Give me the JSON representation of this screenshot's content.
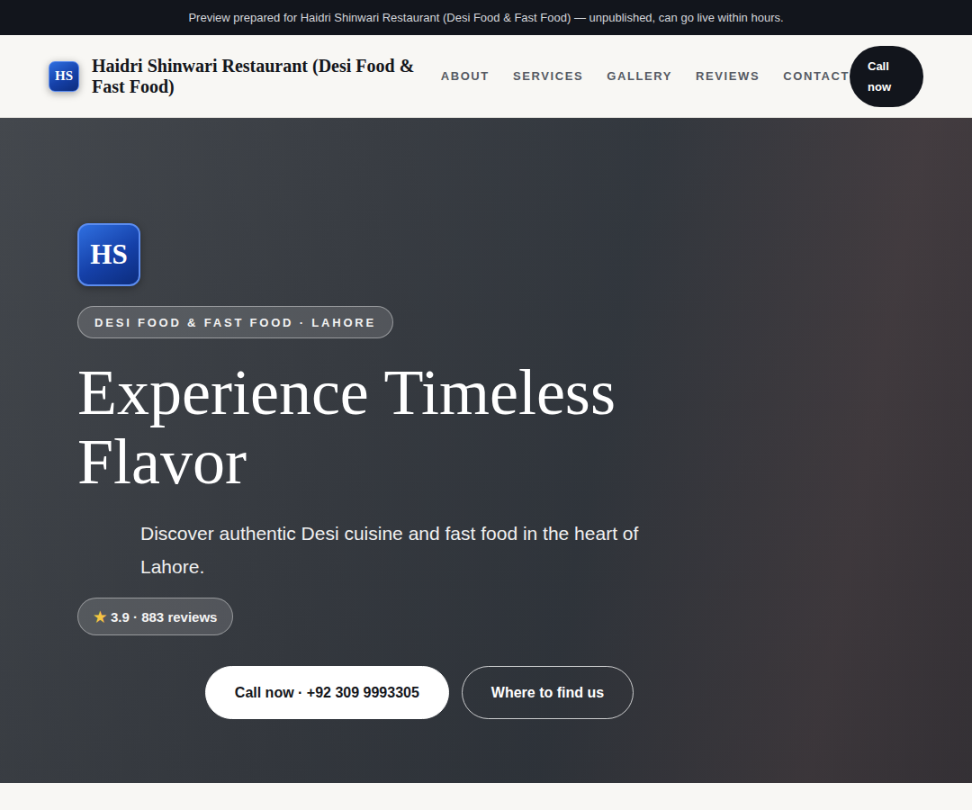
{
  "banner": {
    "text": "Preview prepared for Haidri Shinwari Restaurant (Desi Food & Fast Food) — unpublished, can go live within hours."
  },
  "header": {
    "logo": "HS",
    "title": "Haidri Shinwari Restaurant (Desi Food & Fast Food)",
    "nav": [
      {
        "label": "ABOUT"
      },
      {
        "label": "SERVICES"
      },
      {
        "label": "GALLERY"
      },
      {
        "label": "REVIEWS"
      },
      {
        "label": "CONTACT"
      }
    ],
    "call_button": "Call now"
  },
  "hero": {
    "logo": "HS",
    "badge": "DESI FOOD & FAST FOOD · LAHORE",
    "heading": "Experience Timeless Flavor",
    "subtext": "Discover authentic Desi cuisine and fast food in the heart of Lahore.",
    "rating": {
      "star": "★",
      "text": "3.9 · 883 reviews"
    },
    "buttons": [
      {
        "label": "Call now · +92 309 9993305",
        "kind": "primary"
      },
      {
        "label": "Where to find us",
        "kind": "outline"
      }
    ]
  }
}
